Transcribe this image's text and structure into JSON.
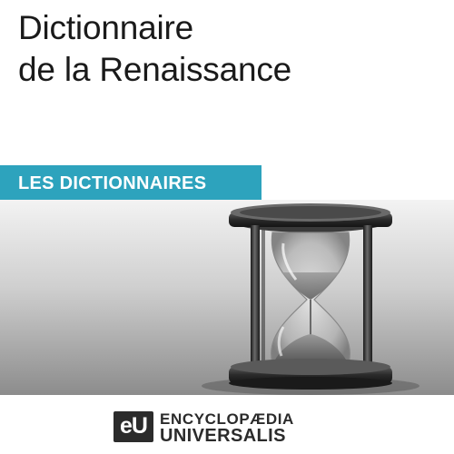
{
  "cover": {
    "title_line1": "Dictionnaire",
    "title_line2": "de la Renaissance",
    "series_label": "LES DICTIONNAIRES",
    "photo_subject": "hourglass-icon",
    "publisher": {
      "mark": "eU",
      "line1": "ENCYCLOPÆDIA",
      "line2": "UNIVERSALIS"
    }
  },
  "colors": {
    "banner": "#2da3bd",
    "title_text": "#1a1a1a",
    "logo": "#2b2b2b"
  }
}
